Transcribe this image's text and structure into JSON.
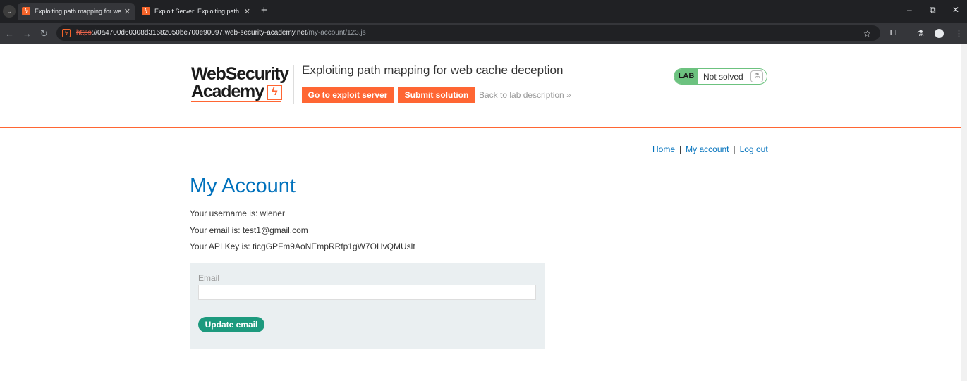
{
  "browser": {
    "tabs": [
      {
        "title": "Exploiting path mapping for we",
        "active": true
      },
      {
        "title": "Exploit Server: Exploiting path m",
        "active": false
      }
    ],
    "url_scheme": "https",
    "url_host": "://0a4700d60308d31682050be700e90097.web-security-academy.net",
    "url_path": "/my-account/123.js",
    "icons": {
      "tab_list": "chevron-down-icon",
      "favicon": "bolt-icon",
      "close": "close-icon",
      "new_tab": "plus-icon",
      "back": "arrow-left-icon",
      "forward": "arrow-right-icon",
      "reload": "reload-icon",
      "bookmark": "star-icon",
      "extensions": "puzzle-icon",
      "labs": "flask-icon",
      "profile": "person-icon",
      "menu": "kebab-icon",
      "minimize": "minimize-icon",
      "restore": "restore-icon",
      "window_close": "close-icon"
    }
  },
  "header": {
    "logo_line1": "WebSecurity",
    "logo_line2": "Academy",
    "lab_title": "Exploiting path mapping for web cache deception",
    "exploit_button": "Go to exploit server",
    "submit_button": "Submit solution",
    "back_link": "Back to lab description",
    "lab_badge": "LAB",
    "lab_status": "Not solved"
  },
  "nav": {
    "home": "Home",
    "separator": "|",
    "my_account": "My account",
    "log_out": "Log out"
  },
  "account": {
    "title": "My Account",
    "username_line": "Your username is: wiener",
    "email_line": "Your email is: test1@gmail.com",
    "api_key_line": "Your API Key is: ticgGPFm9AoNEmpRRfp1gW7OHvQMUslt",
    "email_label": "Email",
    "email_value": "",
    "update_button": "Update email"
  },
  "colors": {
    "accent": "#ff6633",
    "link": "#0071bc",
    "lab_green": "#6cc27f",
    "button_teal": "#1d9a7e",
    "form_bg": "#eaeff1"
  }
}
